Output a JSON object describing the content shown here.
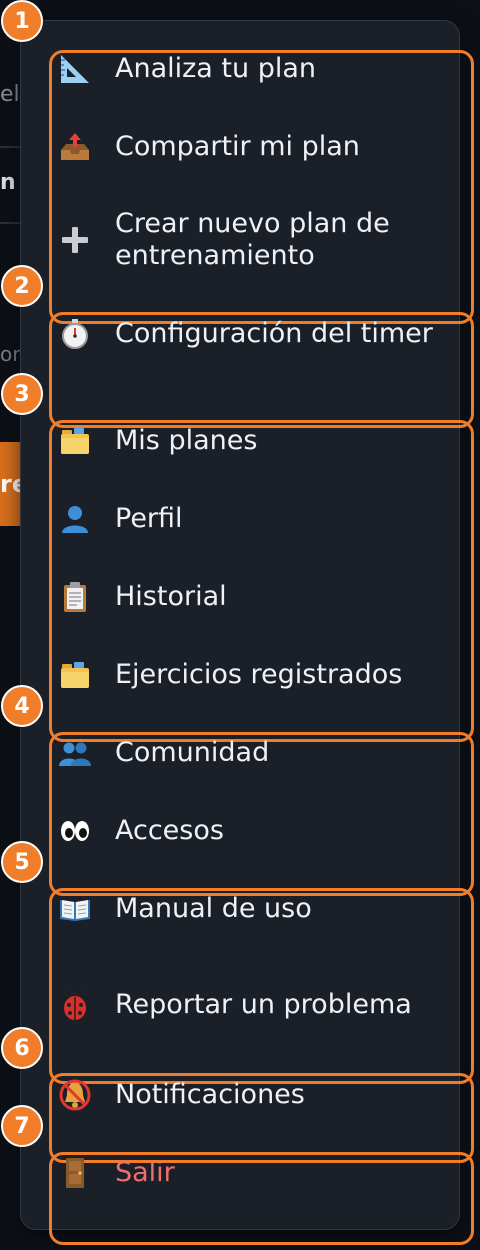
{
  "background": {
    "fragment_1": "el",
    "fragment_2": "n",
    "fragment_3": "or",
    "fragment_4": "re"
  },
  "sections": [
    {
      "badge": "1",
      "items": [
        {
          "label": "Analiza tu plan",
          "icon": "triangle-ruler-icon"
        },
        {
          "label": "Compartir mi plan",
          "icon": "outbox-tray-icon"
        },
        {
          "label": "Crear nuevo plan de entrenamiento",
          "icon": "plus-icon"
        }
      ]
    },
    {
      "badge": "2",
      "items": [
        {
          "label": "Configuración del timer",
          "icon": "stopwatch-icon"
        }
      ]
    },
    {
      "badge": "3",
      "items": [
        {
          "label": "Mis planes",
          "icon": "card-index-dividers-icon"
        },
        {
          "label": "Perfil",
          "icon": "user-silhouette-icon"
        },
        {
          "label": "Historial",
          "icon": "clipboard-icon"
        },
        {
          "label": "Ejercicios registrados",
          "icon": "card-index-dividers-icon"
        }
      ]
    },
    {
      "badge": "4",
      "items": [
        {
          "label": "Comunidad",
          "icon": "users-silhouette-icon"
        },
        {
          "label": "Accesos",
          "icon": "eyes-icon"
        }
      ]
    },
    {
      "badge": "5",
      "items": [
        {
          "label": "Manual de uso",
          "icon": "open-book-icon"
        },
        {
          "label": "Reportar un problema",
          "icon": "ladybug-icon"
        }
      ]
    },
    {
      "badge": "6",
      "items": [
        {
          "label": "Notificaciones",
          "icon": "bell-muted-icon"
        }
      ]
    },
    {
      "badge": "7",
      "items": [
        {
          "label": "Salir",
          "icon": "door-icon"
        }
      ]
    }
  ],
  "colors": {
    "accent": "#f07d2a",
    "panel": "#1a1f28",
    "text": "#eef1f5",
    "danger_text": "#ef6f6f"
  }
}
